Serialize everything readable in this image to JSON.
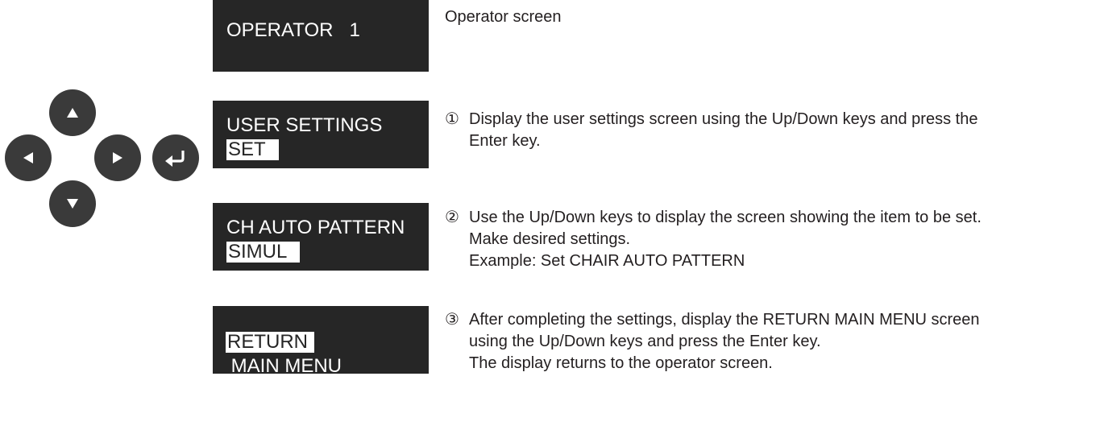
{
  "screens": [
    {
      "line1": "OPERATOR   1",
      "line2_inverted": "",
      "line2_after": ""
    },
    {
      "line1": "USER SETTINGS",
      "line2_inverted": "SET",
      "line2_after": ""
    },
    {
      "line1": "CH AUTO PATTERN",
      "line2_inverted": "SIMUL",
      "line2_after": ""
    },
    {
      "line1": "",
      "line2_inverted": "RETURN",
      "line2_after": " MAIN MENU"
    }
  ],
  "descriptions": [
    {
      "marker": "",
      "lines": [
        "Operator screen"
      ]
    },
    {
      "marker": "①",
      "lines": [
        "Display the user settings screen using the Up/Down keys and press the",
        "Enter key."
      ]
    },
    {
      "marker": "②",
      "lines": [
        "Use the Up/Down keys to display the screen showing the item to be set.",
        "Make desired settings.",
        "Example: Set CHAIR AUTO PATTERN"
      ]
    },
    {
      "marker": "③",
      "lines": [
        "After completing the settings, display the RETURN MAIN MENU screen",
        "using the Up/Down keys and press the Enter key.",
        "The display returns to the operator screen."
      ]
    }
  ],
  "keypad": {
    "keys": [
      "up-arrow-icon",
      "left-arrow-icon",
      "right-arrow-icon",
      "down-arrow-icon",
      "enter-icon"
    ],
    "key_color": "#3a3a3a",
    "glyph_color": "#ffffff"
  },
  "colors": {
    "lcd_background": "#262626",
    "lcd_text": "#ffffff",
    "body_text": "#231f20"
  }
}
